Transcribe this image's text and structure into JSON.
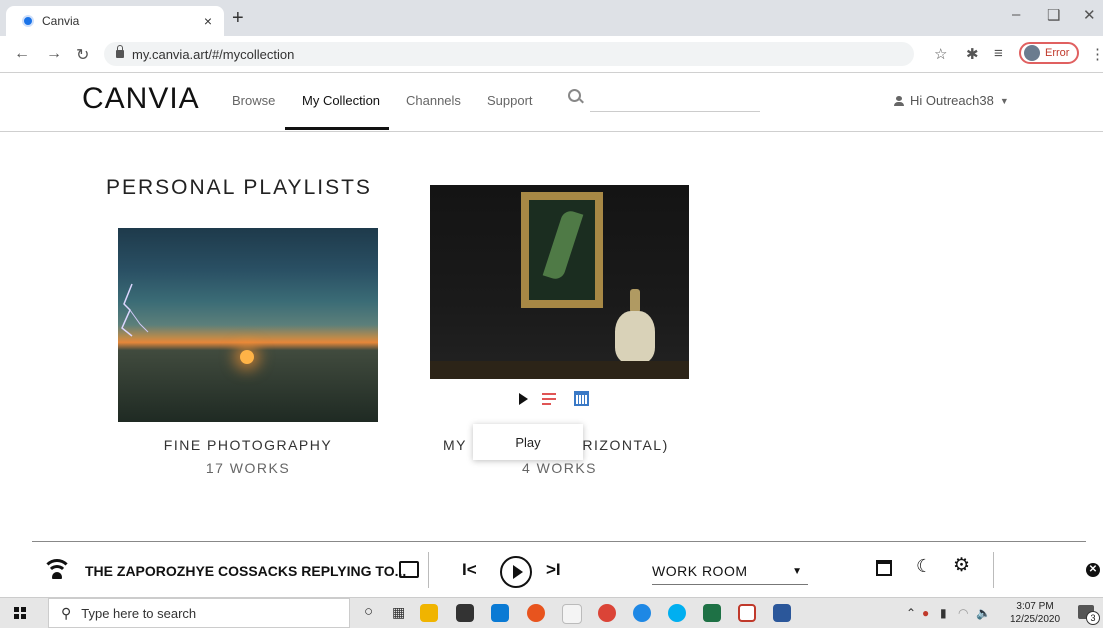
{
  "browser": {
    "tab_title": "Canvia",
    "tab_close": "×",
    "new_tab": "+",
    "url": "my.canvia.art/#/mycollection",
    "profile_status": "Error",
    "icons": [
      "back-icon",
      "forward-icon",
      "reload-icon",
      "lock-icon",
      "star-icon",
      "extensions-icon",
      "media-queue-icon",
      "more-icon"
    ]
  },
  "site": {
    "logo": "CANVIA",
    "nav": [
      {
        "label": "Browse",
        "active": false
      },
      {
        "label": "My Collection",
        "active": true
      },
      {
        "label": "Channels",
        "active": false
      },
      {
        "label": "Support",
        "active": false
      }
    ],
    "search_placeholder": "",
    "user_greeting": "Hi Outreach38"
  },
  "main": {
    "heading": "PERSONAL PLAYLISTS",
    "playlists": [
      {
        "title": "FINE PHOTOGRAPHY",
        "count": "17 WORKS"
      },
      {
        "title_left": "MY",
        "title_right": "ORIZONTAL)",
        "count": "4 WORKS"
      }
    ],
    "tooltip": "Play"
  },
  "player": {
    "now_playing": "THE ZAPOROZHYE COSSACKS REPLYING TO...",
    "prev": "I<",
    "next": ">I",
    "room": "WORK ROOM"
  },
  "taskbar": {
    "search_placeholder": "Type here to search",
    "time": "3:07 PM",
    "date": "12/25/2020",
    "notifications": "3",
    "app_colors": [
      "#f0b400",
      "#ffb900",
      "#0a7ad4",
      "#e8541e",
      "#1e6fd8",
      "#20c997",
      "#1e8449",
      "#c0392b",
      "#2b579a"
    ]
  }
}
